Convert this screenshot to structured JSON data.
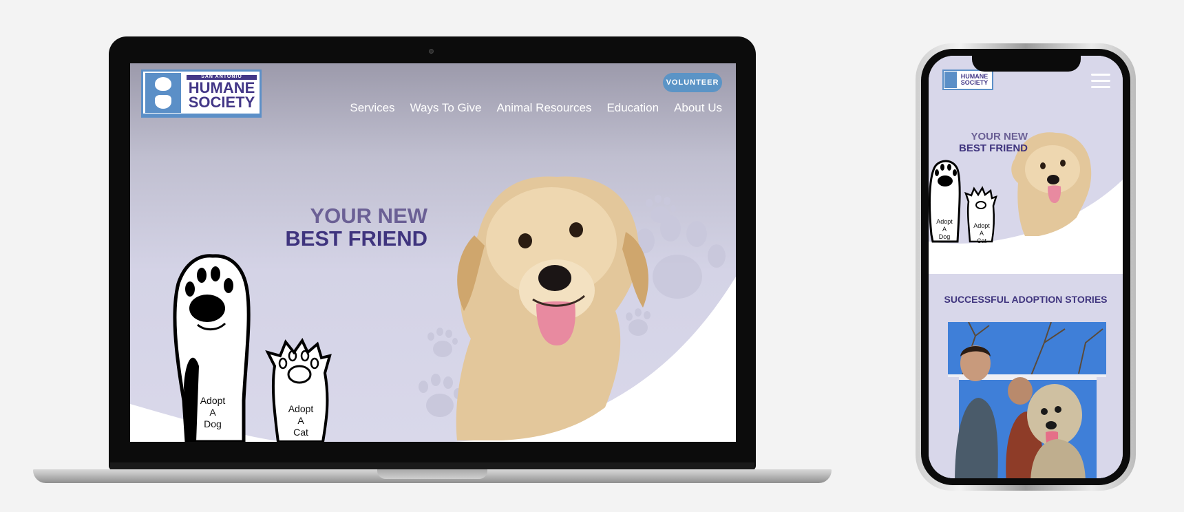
{
  "desktop": {
    "logo": {
      "top_line": "SAN ANTONIO",
      "line1": "HUMANE",
      "line2": "SOCIETY"
    },
    "volunteer_label": "VOLUNTEER",
    "nav": [
      "Services",
      "Ways To Give",
      "Animal Resources",
      "Education",
      "About Us"
    ],
    "hero": {
      "line1": "YOUR NEW",
      "line2": "BEST FRIEND"
    },
    "paws": {
      "dog": [
        "Adopt",
        "A",
        "Dog"
      ],
      "cat": [
        "Adopt",
        "A",
        "Cat"
      ]
    }
  },
  "mobile": {
    "logo": {
      "line1": "HUMANE",
      "line2": "SOCIETY"
    },
    "hero": {
      "line1": "YOUR NEW",
      "line2": "BEST FRIEND"
    },
    "paws": {
      "dog": [
        "Adopt",
        "A",
        "Dog"
      ],
      "cat": [
        "Adopt",
        "A",
        "Cat"
      ]
    },
    "section_heading": "SUCCESSFUL ADOPTION STORIES"
  },
  "colors": {
    "brand_purple": "#433787",
    "brand_blue": "#5b8fc7",
    "hero_bg": "#d9d8ea"
  }
}
